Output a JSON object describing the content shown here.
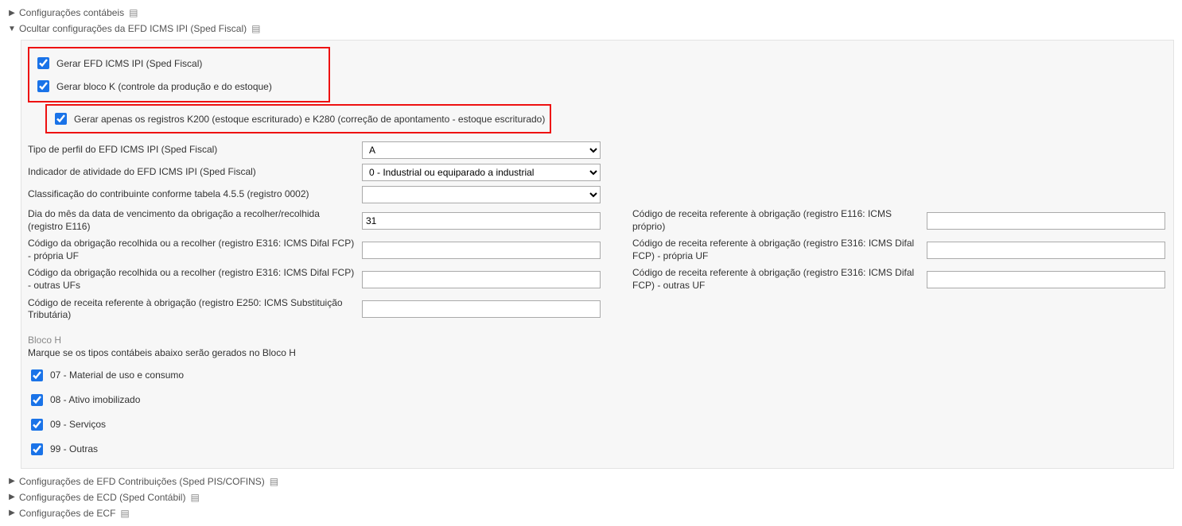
{
  "sections": {
    "contabeis": "Configurações contábeis",
    "efd_icms_ipi": "Ocultar configurações da EFD ICMS IPI (Sped Fiscal)",
    "efd_contrib": "Configurações de EFD Contribuições (Sped PIS/COFINS)",
    "ecd": "Configurações de ECD (Sped Contábil)",
    "ecf": "Configurações de ECF"
  },
  "checks": {
    "gerar_efd": "Gerar EFD ICMS IPI (Sped Fiscal)",
    "gerar_bloco_k": "Gerar bloco K (controle da produção e do estoque)",
    "gerar_k200_k280": "Gerar apenas os registros K200 (estoque escriturado) e K280 (correção de apontamento - estoque escriturado)"
  },
  "fields": {
    "tipo_perfil": {
      "label": "Tipo de perfil do EFD ICMS IPI (Sped Fiscal)",
      "value": "A"
    },
    "indicador_atividade": {
      "label": "Indicador de atividade do EFD ICMS IPI (Sped Fiscal)",
      "value": "0 - Industrial ou equiparado a industrial"
    },
    "classif_contribuinte": {
      "label": "Classificação do contribuinte conforme tabela 4.5.5 (registro 0002)",
      "value": ""
    },
    "dia_vencimento": {
      "label": "Dia do mês da data de vencimento da obrigação a recolher/recolhida (registro E116)",
      "value": "31"
    },
    "cod_receita_e116": {
      "label": "Código de receita referente à obrigação (registro E116: ICMS próprio)"
    },
    "cod_obrig_e316_propria": {
      "label": "Código da obrigação recolhida ou a recolher (registro E316: ICMS Difal FCP) - própria UF"
    },
    "cod_receita_e316_propria": {
      "label": "Código de receita referente à obrigação (registro E316: ICMS Difal FCP) - própria UF"
    },
    "cod_obrig_e316_outras": {
      "label": "Código da obrigação recolhida ou a recolher (registro E316: ICMS Difal FCP) - outras UFs"
    },
    "cod_receita_e316_outras": {
      "label": "Código de receita referente à obrigação (registro E316: ICMS Difal FCP) - outras UF"
    },
    "cod_receita_e250": {
      "label": "Código de receita referente à obrigação (registro E250: ICMS Substituição Tributária)"
    }
  },
  "bloco_h": {
    "title": "Bloco H",
    "note": "Marque se os tipos contábeis abaixo serão gerados no Bloco H",
    "items": [
      "07 - Material de uso e consumo",
      "08 - Ativo imobilizado",
      "09 - Serviços",
      "99 - Outras"
    ]
  }
}
